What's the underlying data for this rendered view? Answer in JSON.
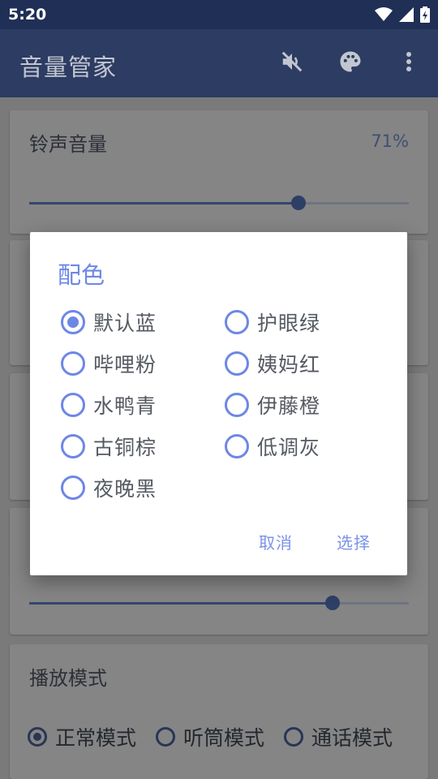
{
  "status": {
    "time": "5:20"
  },
  "appbar": {
    "title": "音量管家"
  },
  "cards": {
    "ringtone": {
      "title": "铃声音量",
      "value": "71%",
      "level": 0.71
    },
    "bottom_slider": {
      "level": 0.8
    },
    "playback": {
      "title": "播放模式",
      "modes": [
        {
          "label": "正常模式",
          "checked": true
        },
        {
          "label": "听筒模式",
          "checked": false
        },
        {
          "label": "通话模式",
          "checked": false
        }
      ]
    }
  },
  "dialog": {
    "title": "配色",
    "options": [
      {
        "label": "默认蓝",
        "checked": true
      },
      {
        "label": "护眼绿",
        "checked": false
      },
      {
        "label": "哔哩粉",
        "checked": false
      },
      {
        "label": "姨妈红",
        "checked": false
      },
      {
        "label": "水鸭青",
        "checked": false
      },
      {
        "label": "伊藤橙",
        "checked": false
      },
      {
        "label": "古铜棕",
        "checked": false
      },
      {
        "label": "低调灰",
        "checked": false
      },
      {
        "label": "夜晚黑",
        "checked": false
      }
    ],
    "cancel_label": "取消",
    "confirm_label": "选择"
  },
  "colors": {
    "accent": "#6d87e6",
    "appbar": "#2c3c62"
  },
  "icons": [
    "wifi-icon",
    "signal-icon",
    "battery-icon",
    "mute-icon",
    "palette-icon",
    "more-vert-icon"
  ]
}
